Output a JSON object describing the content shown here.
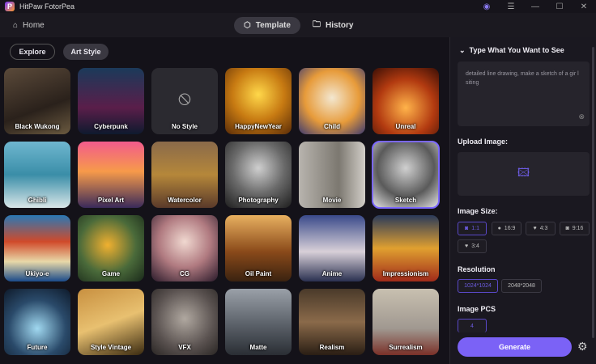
{
  "app": {
    "title": "HitPaw FotorPea"
  },
  "nav": {
    "home": "Home",
    "tabs": [
      {
        "label": "Template"
      },
      {
        "label": "History"
      }
    ]
  },
  "filters": [
    {
      "label": "Explore"
    },
    {
      "label": "Art Style"
    }
  ],
  "styles": [
    {
      "label": "Black Wukong",
      "bg": "linear-gradient(160deg,#5b4a3a,#2a211b 60%,#6b5a40)"
    },
    {
      "label": "Cyberpunk",
      "bg": "linear-gradient(180deg,#1b3a5a,#5a1e4a 60%,#0e1a2e)"
    },
    {
      "label": "No Style",
      "bg": "#2b2a30"
    },
    {
      "label": "HappyNewYear",
      "bg": "radial-gradient(circle at 50% 40%,#ffd84a,#c77a12 50%,#5a2c08)"
    },
    {
      "label": "Child",
      "bg": "radial-gradient(circle at 50% 45%,#f3e7d0,#e79b3a 55%,#3d3a70)"
    },
    {
      "label": "Unreal",
      "bg": "radial-gradient(circle at 50% 60%,#ffb34a,#b23a10 55%,#3a0f06)"
    },
    {
      "label": "Ghibli",
      "bg": "linear-gradient(180deg,#6fb6cf,#3a8ea8 50%,#d9e6e8)"
    },
    {
      "label": "Pixel Art",
      "bg": "linear-gradient(180deg,#f25b8c,#f79a4a 45%,#3a2a5a)"
    },
    {
      "label": "Watercolor",
      "bg": "linear-gradient(180deg,#8a6a4a,#b5873a 50%,#5a3a2a)"
    },
    {
      "label": "Photography",
      "bg": "radial-gradient(circle at 50% 40%,#cfcfcf,#6a6a6a 50%,#1e1e1e)"
    },
    {
      "label": "Movie",
      "bg": "linear-gradient(90deg,#b8b4ae,#7c7870 60%,#d2cec8)"
    },
    {
      "label": "Sketch",
      "bg": "radial-gradient(circle at 50% 40%,#d0d0d0,#5a5a5a 55%,#e8e8e8)"
    },
    {
      "label": "Ukiyo-e",
      "bg": "linear-gradient(180deg,#2a78b5,#d04a2a 40%,#e8d8a8 70%,#1a4a8a)"
    },
    {
      "label": "Game",
      "bg": "radial-gradient(circle at 45% 45%,#f0b030,#4a6a3a 55%,#1a2a1a)"
    },
    {
      "label": "CG",
      "bg": "radial-gradient(circle at 50% 40%,#f0d8d0,#b07a80 50%,#2a1a2a)"
    },
    {
      "label": "Oil Paint",
      "bg": "linear-gradient(180deg,#e8b060,#8a4a1a 55%,#3a2210)"
    },
    {
      "label": "Anime",
      "bg": "linear-gradient(180deg,#3a4a8a,#d8d0d8 55%,#2a3050)"
    },
    {
      "label": "Impressionism",
      "bg": "linear-gradient(180deg,#2a3a5a,#e0a030 50%,#a02a1a)"
    },
    {
      "label": "Future",
      "bg": "radial-gradient(circle at 50% 60%,#a0d8f0,#2a4a6a 55%,#0e1a2a)"
    },
    {
      "label": "Style Vintage",
      "bg": "linear-gradient(160deg,#c89040,#e8c070 50%,#3a2a10)"
    },
    {
      "label": "VFX",
      "bg": "radial-gradient(circle at 50% 45%,#b0a8a0,#5a5250 60%,#2a2624)"
    },
    {
      "label": "Matte",
      "bg": "linear-gradient(180deg,#9aa0a8,#5a6068 55%,#2a2e34)"
    },
    {
      "label": "Realism",
      "bg": "linear-gradient(180deg,#4a3a2a,#8a6a4a 50%,#2a1e14)"
    },
    {
      "label": "Surrealism",
      "bg": "linear-gradient(180deg,#c8c0b0,#a09890 60%,#7a3028)"
    }
  ],
  "selected_style": "Sketch",
  "panel": {
    "prompt_header": "Type What You Want to See",
    "prompt_text": "detailed line drawing, make a sketch of a gir l siting",
    "upload_label": "Upload Image:",
    "size_label": "Image Size:",
    "sizes": [
      {
        "label": "1:1",
        "selected": true
      },
      {
        "label": "16:9"
      },
      {
        "label": "4:3"
      },
      {
        "label": "9:16"
      },
      {
        "label": "3:4"
      }
    ],
    "resolution_label": "Resolution",
    "resolutions": [
      {
        "label": "1024*1024",
        "selected": true
      },
      {
        "label": "2048*2048"
      }
    ],
    "pcs_label": "Image PCS",
    "pcs_value": "4",
    "generate": "Generate"
  },
  "colors": {
    "accent": "#7b62f6"
  }
}
